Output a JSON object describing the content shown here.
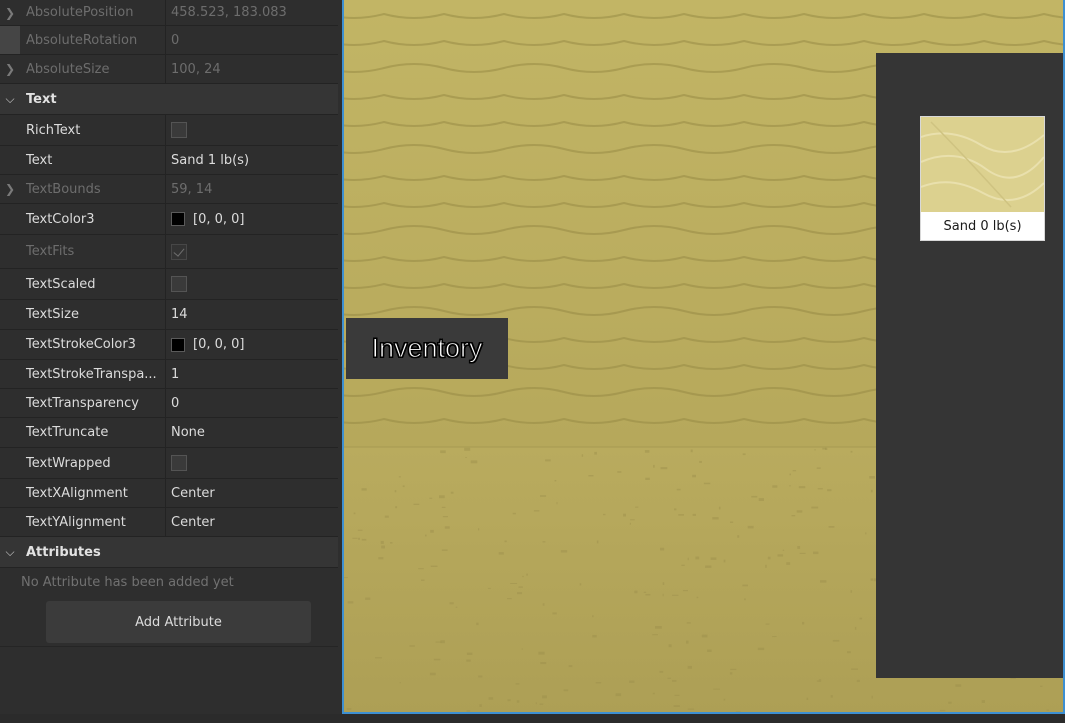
{
  "properties": {
    "rows_top": [
      {
        "name": "AbsolutePosition",
        "value": "458.523, 183.083",
        "disabled": true,
        "expandable": true
      },
      {
        "name": "AbsoluteRotation",
        "value": "0",
        "disabled": true,
        "expandable": false
      },
      {
        "name": "AbsoluteSize",
        "value": "100, 24",
        "disabled": true,
        "expandable": true
      }
    ],
    "text_section": {
      "title": "Text",
      "rows": [
        {
          "name": "RichText",
          "kind": "checkbox",
          "checked": false,
          "disabled": false
        },
        {
          "name": "Text",
          "value": "Sand 1 lb(s)",
          "disabled": false
        },
        {
          "name": "TextBounds",
          "value": "59, 14",
          "disabled": true,
          "expandable": true
        },
        {
          "name": "TextColor3",
          "kind": "color",
          "color": "#000000",
          "value": "[0, 0, 0]",
          "disabled": false
        },
        {
          "name": "TextFits",
          "kind": "checkbox",
          "checked": true,
          "disabled": true
        },
        {
          "name": "TextScaled",
          "kind": "checkbox",
          "checked": false,
          "disabled": false
        },
        {
          "name": "TextSize",
          "value": "14",
          "disabled": false
        },
        {
          "name": "TextStrokeColor3",
          "kind": "color",
          "color": "#000000",
          "value": "[0, 0, 0]",
          "disabled": false
        },
        {
          "name": "TextStrokeTranspa...",
          "value": "1",
          "disabled": false
        },
        {
          "name": "TextTransparency",
          "value": "0",
          "disabled": false
        },
        {
          "name": "TextTruncate",
          "value": "None",
          "disabled": false
        },
        {
          "name": "TextWrapped",
          "kind": "checkbox",
          "checked": false,
          "disabled": false
        },
        {
          "name": "TextXAlignment",
          "value": "Center",
          "disabled": false
        },
        {
          "name": "TextYAlignment",
          "value": "Center",
          "disabled": false
        }
      ]
    },
    "attributes_section": {
      "title": "Attributes",
      "empty_message": "No Attribute has been added yet",
      "add_button_label": "Add Attribute"
    }
  },
  "viewport": {
    "inventory_button_label": "Inventory",
    "slot_label": "Sand 0 lb(s)"
  },
  "colors": {
    "accent_border": "#3d8fd1",
    "sand_wall": "#bdb05f",
    "sand_floor": "#b3a55a"
  }
}
